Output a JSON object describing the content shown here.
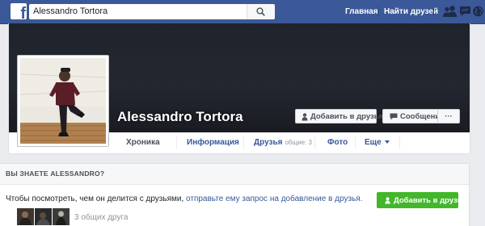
{
  "topbar": {
    "logo": "f",
    "search_value": "Alessandro Tortora",
    "search_icon": "search-icon",
    "nav": {
      "home": "Главная",
      "find_friends": "Найти друзей"
    },
    "icons": [
      "friend-requests-icon",
      "messages-icon",
      "globe-icon"
    ]
  },
  "profile": {
    "name": "Alessandro Tortora",
    "add_friend": "Добавить в друзья",
    "message": "Сообщение",
    "more": "···",
    "tabs": {
      "timeline": "Хроника",
      "about": "Информация",
      "friends": "Друзья",
      "friends_count": "общие: 3",
      "photos": "Фото",
      "more": "Еще"
    }
  },
  "know": {
    "title": "ВЫ ЗНАЕТЕ ALESSANDRO?",
    "text": "Чтобы посмотреть, чем он делится с друзьями,",
    "link": "отправьте ему запрос на добавление в друзья.",
    "add_friend": "Добавить в друзья",
    "mutual": "3 общих друга"
  },
  "colors": {
    "brand": "#3b5998",
    "link": "#365899",
    "green": "#42b72a"
  }
}
